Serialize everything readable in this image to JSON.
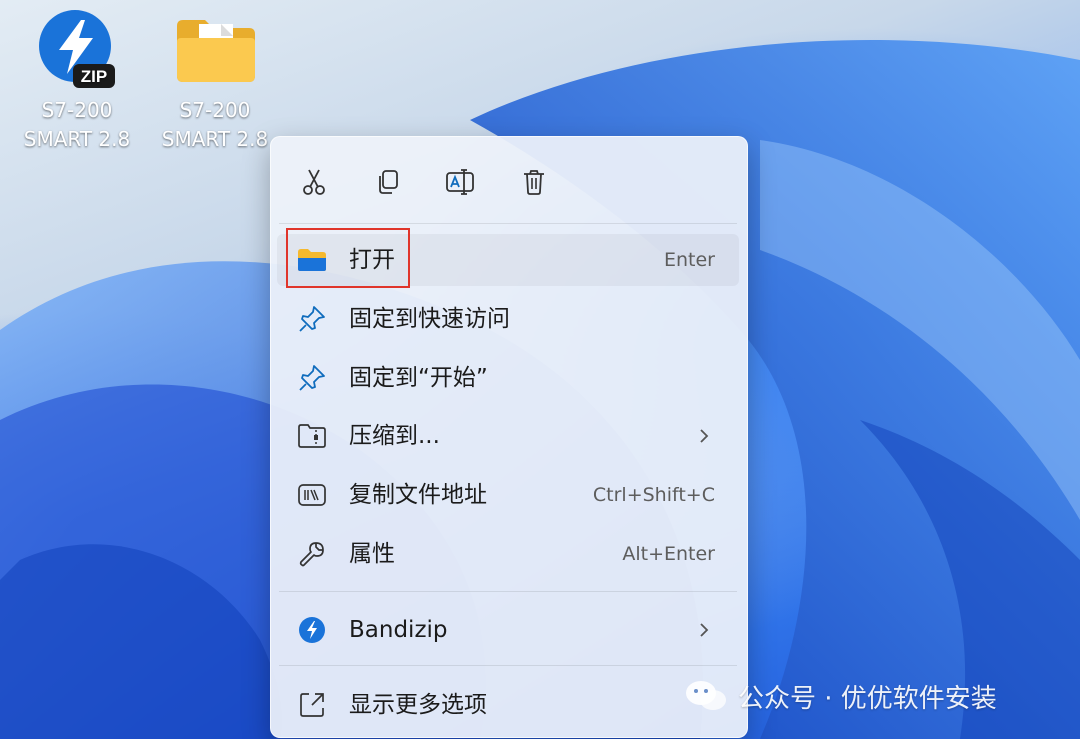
{
  "desktop": {
    "icons": [
      {
        "name": "zip-file-icon",
        "badge": "ZIP",
        "line1": "S7-200",
        "line2": "SMART 2.8"
      },
      {
        "name": "folder-icon",
        "line1": "S7-200",
        "line2": "SMART 2.8"
      }
    ]
  },
  "context_menu": {
    "toolbar": [
      {
        "icon": "cut-icon"
      },
      {
        "icon": "copy-icon"
      },
      {
        "icon": "rename-icon"
      },
      {
        "icon": "delete-icon"
      }
    ],
    "items": [
      {
        "icon": "folder-open-icon",
        "label": "打开",
        "shortcut": "Enter"
      },
      {
        "icon": "pin-icon",
        "label": "固定到快速访问",
        "shortcut": ""
      },
      {
        "icon": "pin-icon",
        "label": "固定到“开始”",
        "shortcut": ""
      },
      {
        "icon": "compress-icon",
        "label": "压缩到...",
        "shortcut": ""
      },
      {
        "icon": "copy-path-icon",
        "label": "复制文件地址",
        "shortcut": "Ctrl+Shift+C"
      },
      {
        "icon": "wrench-icon",
        "label": "属性",
        "shortcut": "Alt+Enter"
      },
      {
        "icon": "bandizip-icon",
        "label": "Bandizip",
        "shortcut": ""
      },
      {
        "icon": "more-options-icon",
        "label": "显示更多选项",
        "shortcut": ""
      }
    ]
  },
  "watermark": {
    "text": "公众号 · 优优软件安装"
  },
  "colors": {
    "accent": "#0f6cbd",
    "highlight_border": "#e0352b",
    "folder": "#f5c342"
  }
}
